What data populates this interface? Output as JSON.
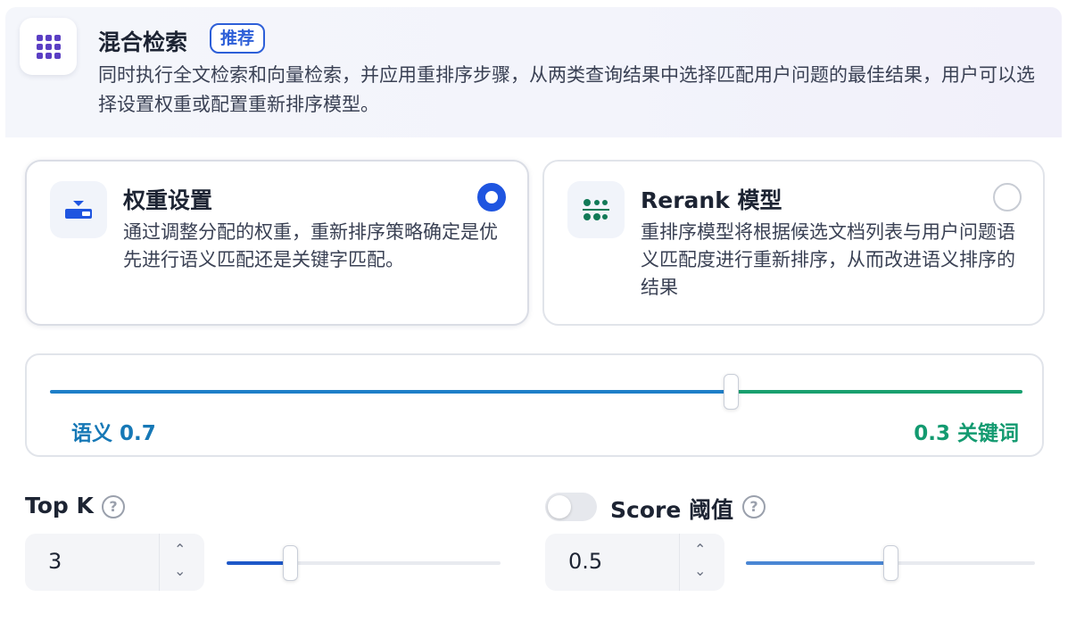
{
  "header": {
    "icon": "grid-dots-icon",
    "title": "混合检索",
    "badge": "推荐",
    "description": "同时执行全文检索和向量检索，并应用重排序步骤，从两类查询结果中选择匹配用户问题的最佳结果，用户可以选择设置权重或配置重新排序模型。"
  },
  "options": {
    "weight": {
      "icon": "weight-settings-icon",
      "title": "权重设置",
      "description": "通过调整分配的权重，重新排序策略确定是优先进行语义匹配还是关键字匹配。",
      "selected": true
    },
    "rerank": {
      "icon": "rerank-model-icon",
      "title": "Rerank 模型",
      "description": "重排序模型将根据候选文档列表与用户问题语义匹配度进行重新排序，从而改进语义排序的结果",
      "selected": false
    }
  },
  "weight_slider": {
    "semantic_label": "语义 0.7",
    "keyword_label": "0.3 关键词",
    "semantic_value": 0.7,
    "keyword_value": 0.3,
    "colors": {
      "semantic": "#1e7fc8",
      "keyword": "#19a06f"
    }
  },
  "top_k": {
    "label": "Top K",
    "help_icon": "question-circle-icon",
    "value": "3",
    "slider_fraction": 0.23
  },
  "score_threshold": {
    "label": "Score 阈值",
    "help_icon": "question-circle-icon",
    "enabled": false,
    "value": "0.5",
    "slider_fraction": 0.5
  },
  "colors": {
    "accent": "#1f55e0",
    "brand_icon": "#5b3fc4"
  }
}
